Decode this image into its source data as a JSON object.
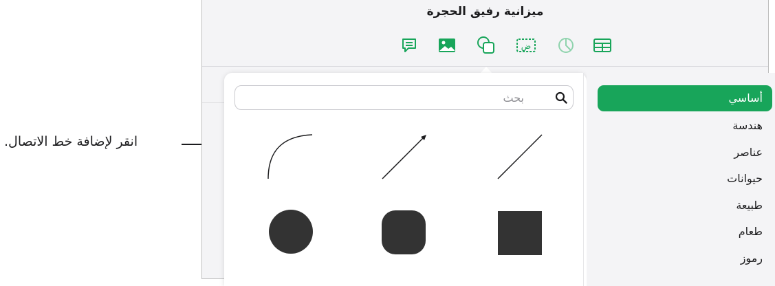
{
  "document": {
    "title": "ميزانية رفيق الحجرة"
  },
  "toolbar": {
    "items": [
      {
        "name": "comment",
        "icon": "comment-icon"
      },
      {
        "name": "media",
        "icon": "media-icon"
      },
      {
        "name": "shape",
        "icon": "shape-icon",
        "active": true
      },
      {
        "name": "text",
        "icon": "text-box-icon",
        "glyph": "ض"
      },
      {
        "name": "chart",
        "icon": "chart-icon"
      },
      {
        "name": "table",
        "icon": "table-icon"
      }
    ],
    "accent_color": "#18a55a"
  },
  "shapes_popover": {
    "search": {
      "placeholder": "بحث",
      "value": ""
    },
    "categories": [
      {
        "label": "أساسي",
        "selected": true
      },
      {
        "label": "هندسة"
      },
      {
        "label": "عناصر"
      },
      {
        "label": "حيوانات"
      },
      {
        "label": "طبيعة"
      },
      {
        "label": "طعام"
      },
      {
        "label": "رموز"
      }
    ],
    "shapes": [
      {
        "name": "curved-line"
      },
      {
        "name": "arrow-line"
      },
      {
        "name": "straight-line"
      },
      {
        "name": "circle"
      },
      {
        "name": "rounded-square"
      },
      {
        "name": "square"
      }
    ]
  },
  "callout": {
    "text": "انقر لإضافة خط الاتصال."
  }
}
